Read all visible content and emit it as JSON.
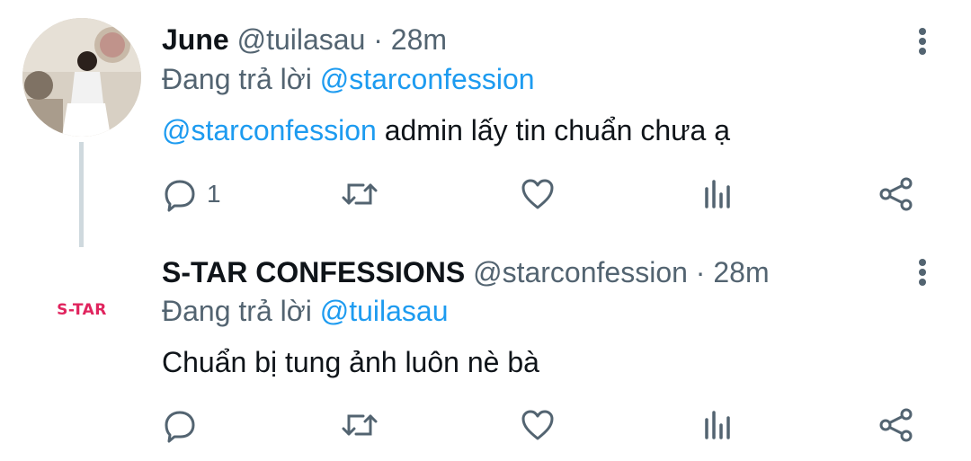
{
  "tweets": [
    {
      "name": "June",
      "handle": "@tuilasau",
      "separator": "·",
      "time": "28m",
      "reply_prefix": "Đang trả lời",
      "reply_to": "@starconfession",
      "body_mention": "@starconfession",
      "body_text": " admin lấy tin chuẩn chưa ạ",
      "reply_count": "1",
      "avatar": "photo"
    },
    {
      "name": "S-TAR CONFESSIONS",
      "handle": "@starconfession",
      "separator": "·",
      "time": "28m",
      "reply_prefix": "Đang trả lời",
      "reply_to": "@tuilasau",
      "body_text": "Chuẩn bị tung ảnh luôn nè bà",
      "avatar_logo": "S-TAR"
    }
  ],
  "colors": {
    "accent": "#1d9bf0",
    "secondary_text": "#536471",
    "icon": "#536471",
    "logo": "#e0245e",
    "thread_line": "#cfd9de"
  },
  "icons": [
    "reply-icon",
    "retweet-icon",
    "like-icon",
    "views-icon",
    "share-icon",
    "more-icon"
  ]
}
